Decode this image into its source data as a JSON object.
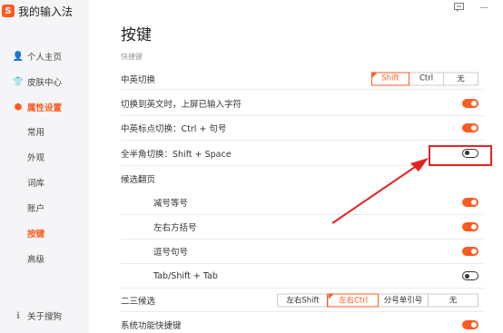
{
  "app": {
    "logo_char": "S",
    "title": "我的输入法"
  },
  "topbar": {
    "icons": [
      "chat-icon",
      "minimize-icon"
    ],
    "minimize_glyph": "—"
  },
  "sidebar": {
    "items": [
      {
        "label": "个人主页",
        "icon": "user-icon",
        "glyph": "👤"
      },
      {
        "label": "皮肤中心",
        "icon": "shirt-icon",
        "glyph": "👕"
      },
      {
        "label": "属性设置",
        "icon": "settings-icon",
        "glyph": "⬢"
      }
    ],
    "subitems": [
      {
        "label": "常用"
      },
      {
        "label": "外观"
      },
      {
        "label": "词库"
      },
      {
        "label": "账户"
      },
      {
        "label": "按键"
      },
      {
        "label": "高级"
      }
    ],
    "footer": {
      "label": "关于搜狗",
      "icon": "info-icon",
      "glyph": "ℹ"
    }
  },
  "main": {
    "title": "按键",
    "section": "快捷键",
    "rows": [
      {
        "label": "中英切换",
        "options": [
          "Shift",
          "Ctrl",
          "无"
        ],
        "selected": "Shift"
      },
      {
        "label": "切换到英文时，上屏已输入字符",
        "toggle": "on"
      },
      {
        "label": "中英标点切换：Ctrl + 句号",
        "toggle": "on"
      },
      {
        "label": "全半角切换：Shift + Space",
        "toggle": "off"
      },
      {
        "label": "候选翻页"
      },
      {
        "label": "减号等号",
        "toggle": "on"
      },
      {
        "label": "左右方括号",
        "toggle": "on"
      },
      {
        "label": "逗号句号",
        "toggle": "on"
      },
      {
        "label": "Tab/Shift + Tab",
        "toggle": "off"
      },
      {
        "label": "二三候选",
        "options": [
          "左右Shift",
          "左右Ctrl",
          "分号单引号",
          "无"
        ],
        "selected": "左右Ctrl"
      },
      {
        "label": "系统功能快捷键",
        "toggle": "on"
      }
    ]
  },
  "colors": {
    "accent": "#ff5a1f",
    "highlight": "#e52222",
    "sidebar_bg": "#f5f5f7"
  }
}
